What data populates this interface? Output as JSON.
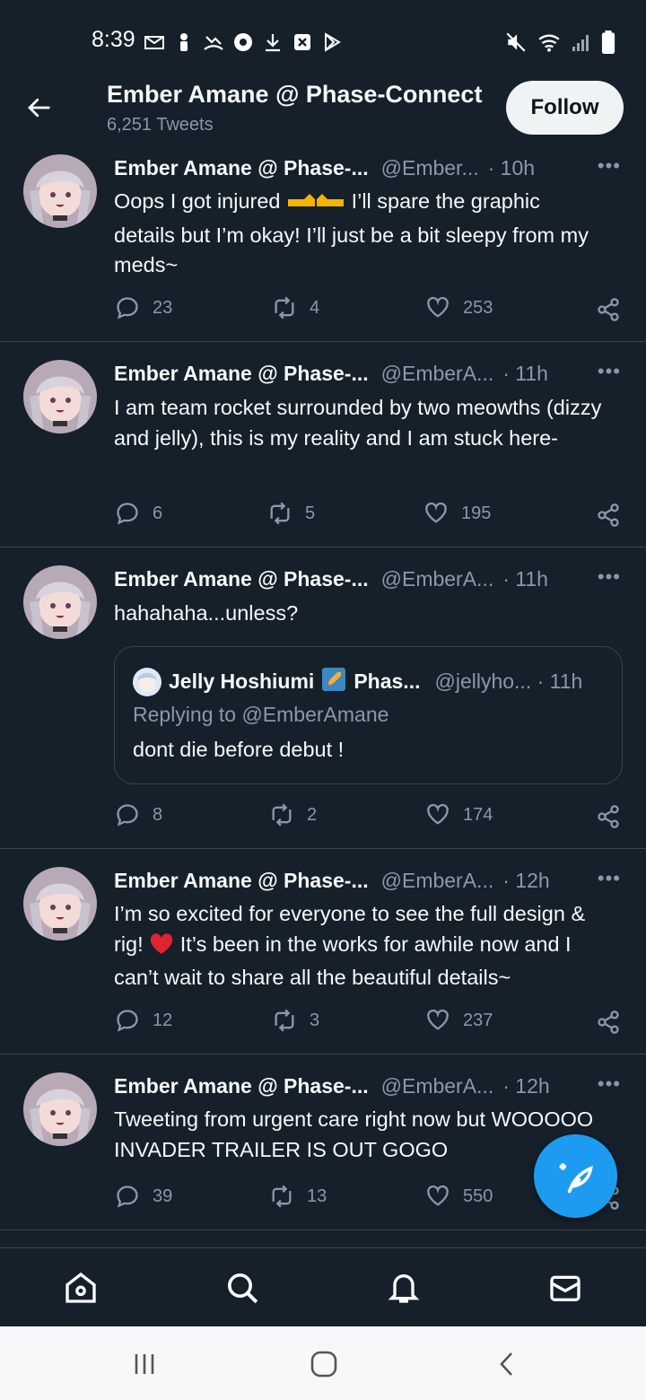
{
  "status_bar": {
    "time": "8:39"
  },
  "header": {
    "title": "Ember Amane @ Phase-Connect",
    "subtitle": "6,251 Tweets",
    "follow_label": "Follow"
  },
  "tweets": [
    {
      "name": "Ember Amane @ Phase-...",
      "handle": "@Ember...",
      "time": "· 10h",
      "text_line1_a": "Oops I got injured",
      "text_line1_b": "I’ll spare the graphic",
      "text_rest": "details but I’m okay! I’ll just be a bit sleepy from my meds~",
      "replies": "23",
      "retweets": "4",
      "likes": "253"
    },
    {
      "name": "Ember Amane @ Phase-...",
      "handle": "@EmberA...",
      "time": "· 11h",
      "text": "I am team rocket surrounded by two meowths (dizzy and jelly), this is my reality and I am stuck here-",
      "replies": "6",
      "retweets": "5",
      "likes": "195"
    },
    {
      "name": "Ember Amane @ Phase-...",
      "handle": "@EmberA...",
      "time": "· 11h",
      "text": "hahahaha...unless?",
      "quote": {
        "name": "Jelly Hoshiumi",
        "name_suffix": "Phas...",
        "handle": "@jellyho... · 11h",
        "replying": "Replying to @EmberAmane",
        "text": "dont die before debut !"
      },
      "replies": "8",
      "retweets": "2",
      "likes": "174"
    },
    {
      "name": "Ember Amane @ Phase-...",
      "handle": "@EmberA...",
      "time": "· 12h",
      "text_line1": "I’m so excited for everyone to see the full design &",
      "text_line2_a": "rig!",
      "text_line2_b": "It’s been in the works for awhile now and I",
      "text_line3": "can’t wait to share all the beautiful details~",
      "replies": "12",
      "retweets": "3",
      "likes": "237"
    },
    {
      "name": "Ember Amane @ Phase-...",
      "handle": "@EmberA...",
      "time": "· 12h",
      "text": "Tweeting from urgent care right now but WOOOOO INVADER TRAILER IS OUT GOGO",
      "replies": "39",
      "retweets": "13",
      "likes": "550"
    }
  ],
  "colors": {
    "background": "#15202b",
    "accent": "#1d9bf0",
    "muted": "#8b98a5",
    "border": "#38444d"
  }
}
